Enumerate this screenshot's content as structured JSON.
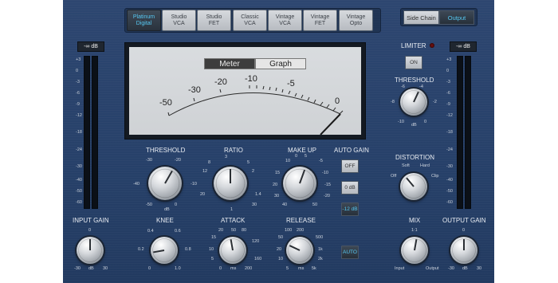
{
  "models": [
    {
      "label": "Platinum\nDigital",
      "active": true
    },
    {
      "label": "Studio\nVCA",
      "active": false
    },
    {
      "label": "Studio\nFET",
      "active": false
    },
    {
      "label": "Classic\nVCA",
      "active": false
    },
    {
      "label": "Vintage\nVCA",
      "active": false
    },
    {
      "label": "Vintage\nFET",
      "active": false
    },
    {
      "label": "Vintage\nOpto",
      "active": false
    }
  ],
  "output_toggle": {
    "side_chain": "Side Chain",
    "output": "Output",
    "selected": "Output"
  },
  "meter": {
    "tabs": {
      "meter": "Meter",
      "graph": "Graph",
      "selected": "Meter"
    },
    "scale": [
      "-50",
      "-30",
      "-20",
      "-10",
      "-5",
      "0"
    ]
  },
  "input_meter": {
    "readout": "-∞ dB",
    "scale": [
      "+3",
      "0",
      "-3",
      "-6",
      "-9",
      "-12",
      "-18",
      "-24",
      "-30",
      "-40",
      "-50",
      "-60"
    ]
  },
  "output_meter": {
    "readout": "-∞ dB",
    "scale": [
      "+3",
      "0",
      "-3",
      "-6",
      "-9",
      "-12",
      "-18",
      "-24",
      "-30",
      "-40",
      "-50",
      "-60"
    ]
  },
  "limiter": {
    "label": "LIMITER",
    "button": "ON",
    "threshold": {
      "label": "THRESHOLD",
      "ticks": [
        "-6",
        "-4",
        "-8",
        "-2",
        "-10",
        "0"
      ],
      "unit": "dB"
    }
  },
  "controls": {
    "threshold": {
      "label": "THRESHOLD",
      "ticks": [
        "-30",
        "-20",
        "-40",
        "-10",
        "-50",
        "0"
      ],
      "unit": "dB"
    },
    "ratio": {
      "label": "RATIO",
      "ticks": [
        "3",
        "5",
        "8",
        "2",
        "12",
        "1.4",
        "20",
        "1",
        "30"
      ]
    },
    "make_up": {
      "label": "MAKE UP",
      "ticks": [
        "0",
        "5",
        "10",
        "-5",
        "15",
        "-10",
        "20",
        "-15",
        "30",
        "-20",
        "40",
        "50"
      ]
    },
    "knee": {
      "label": "KNEE",
      "ticks": [
        "0.4",
        "0.6",
        "0.2",
        "0.8",
        "0",
        "1.0"
      ]
    },
    "attack": {
      "label": "ATTACK",
      "ticks": [
        "20",
        "50",
        "80",
        "15",
        "120",
        "10",
        "5",
        "160",
        "0",
        "200"
      ],
      "unit": "ms"
    },
    "release": {
      "label": "RELEASE",
      "ticks": [
        "100",
        "200",
        "50",
        "500",
        "20",
        "1k",
        "10",
        "2k",
        "5",
        "5k"
      ],
      "unit": "ms"
    },
    "input_gain": {
      "label": "INPUT GAIN",
      "ticks": [
        "0",
        "-30",
        "30"
      ],
      "unit": "dB"
    },
    "output_gain": {
      "label": "OUTPUT GAIN",
      "ticks": [
        "0",
        "-30",
        "30"
      ],
      "unit": "dB"
    },
    "mix": {
      "label": "MIX",
      "ticks": [
        "1:1",
        "Input",
        "Output"
      ]
    },
    "distortion": {
      "label": "DISTORTION",
      "ticks": [
        "Soft",
        "Hard",
        "Off",
        "Clip"
      ]
    }
  },
  "auto_gain": {
    "label": "AUTO GAIN",
    "options": [
      "OFF",
      "0 dB",
      "-12 dB"
    ],
    "selected": "-12 dB"
  },
  "release_auto": {
    "label": "AUTO",
    "active": true
  }
}
